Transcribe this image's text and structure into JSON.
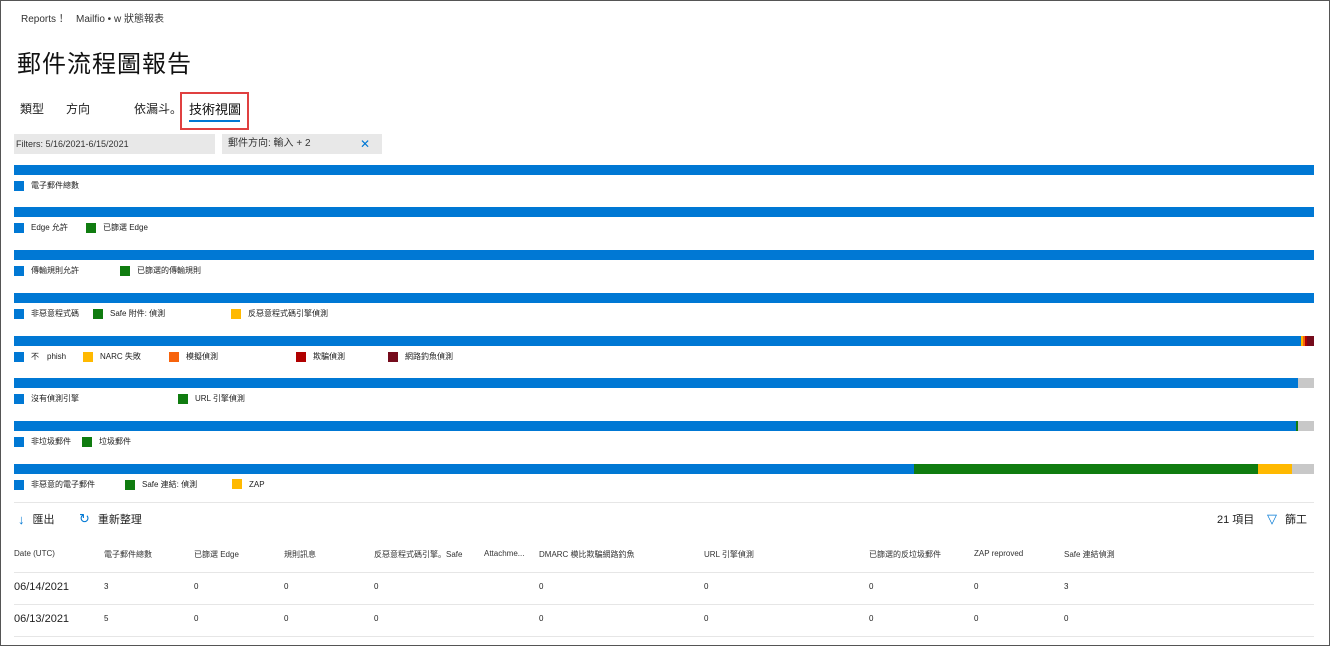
{
  "breadcrumb": {
    "root": "Reports ！",
    "current": "Mailfio • w 狀態報表"
  },
  "page_title": "郵件流程圖報告",
  "tabs": [
    "類型",
    "方向",
    "依漏斗。",
    "技術視圖"
  ],
  "active_tab": "技術視圖",
  "filters": {
    "date": "Filters: 5/16/2021-6/15/2021",
    "direction": "郵件方向: 輸入 + 2"
  },
  "colors": {
    "blue": "#0078d4",
    "green": "#107c10",
    "yellow": "#ffb900",
    "orange": "#f7630c",
    "red": "#b00000",
    "darkred": "#750b1c",
    "gray": "#c8c8c8",
    "accent_highlight": "#e04040"
  },
  "chart_data": [
    {
      "type": "bar",
      "series": [
        {
          "name": "電子郵件總數",
          "value": 100,
          "color": "blue"
        }
      ]
    },
    {
      "type": "bar",
      "series": [
        {
          "name": "Edge 允許",
          "value": 100,
          "color": "blue"
        },
        {
          "name": "已篩選 Edge",
          "value": 0,
          "color": "green"
        }
      ]
    },
    {
      "type": "bar",
      "series": [
        {
          "name": "傳輸規則允許",
          "value": 100,
          "color": "blue"
        },
        {
          "name": "已篩選的傳輸規則",
          "value": 0,
          "color": "green"
        }
      ]
    },
    {
      "type": "bar",
      "series": [
        {
          "name": "非惡意程式碼",
          "value": 100,
          "color": "blue"
        },
        {
          "name": "Safe 附件: 偵測",
          "value": 0,
          "color": "green"
        },
        {
          "name": "反惡意程式碼引擎偵測",
          "value": 0,
          "color": "yellow"
        }
      ]
    },
    {
      "type": "bar",
      "series": [
        {
          "name": "不　phish",
          "value": 99.0,
          "color": "blue"
        },
        {
          "name": "NARC 失敗",
          "value": 0.15,
          "color": "yellow"
        },
        {
          "name": "模擬偵測",
          "value": 0.15,
          "color": "orange"
        },
        {
          "name": "欺騙偵測",
          "value": 0.15,
          "color": "red"
        },
        {
          "name": "網路釣魚偵測",
          "value": 0.55,
          "color": "darkred"
        }
      ]
    },
    {
      "type": "bar",
      "series": [
        {
          "name": "沒有偵測引擎",
          "value": 98.8,
          "color": "blue"
        },
        {
          "name": "URL 引擎偵測",
          "value": 0,
          "color": "green"
        },
        {
          "name": "",
          "value": 1.2,
          "color": "gray"
        }
      ]
    },
    {
      "type": "bar",
      "series": [
        {
          "name": "非垃圾郵件",
          "value": 98.6,
          "color": "blue"
        },
        {
          "name": "垃圾郵件",
          "value": 0.2,
          "color": "green"
        },
        {
          "name": "",
          "value": 1.2,
          "color": "gray"
        }
      ]
    },
    {
      "type": "bar",
      "series": [
        {
          "name": "非惡意的電子郵件",
          "value": 69.2,
          "color": "blue"
        },
        {
          "name": "Safe 連結: 偵測",
          "value": 26.5,
          "color": "green"
        },
        {
          "name": "ZAP",
          "value": 2.6,
          "color": "yellow"
        },
        {
          "name": "",
          "value": 1.7,
          "color": "gray"
        }
      ]
    }
  ],
  "toolbar": {
    "export": "匯出",
    "refresh": "重新整理",
    "count": "21 項目",
    "filter": "篩工"
  },
  "table": {
    "headers": [
      "Date (UTC)",
      "電子郵件總數",
      "已篩選 Edge",
      "規則訊息",
      "反惡意程式碼引擎。Safe",
      "Attachme...",
      "DMARC 模比欺騙網路釣魚",
      "URL 引擎偵測",
      "已篩選的反垃圾郵件",
      "ZAP reproved",
      "Safe 連結偵測"
    ],
    "rows": [
      [
        "06/14/2021",
        "3",
        "0",
        "0",
        "0",
        "",
        "0",
        "0",
        "0",
        "0",
        "3"
      ],
      [
        "06/13/2021",
        "5",
        "0",
        "0",
        "0",
        "",
        "0",
        "0",
        "0",
        "0",
        "0"
      ]
    ]
  }
}
